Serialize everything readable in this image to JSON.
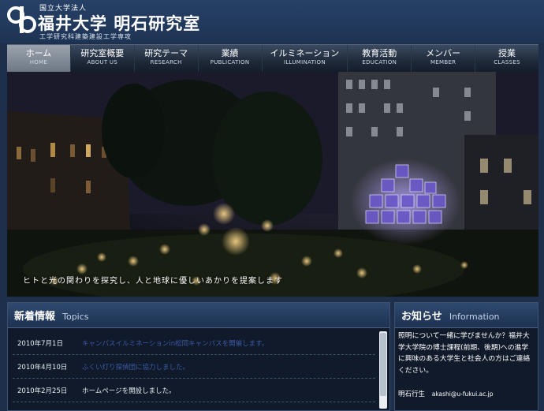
{
  "header": {
    "org": "国立大学法人",
    "title": "福井大学 明石研究室",
    "dept": "工学研究科建築建設工学専攻"
  },
  "nav": [
    {
      "jp": "ホーム",
      "en": "HOME",
      "active": true
    },
    {
      "jp": "研究室概要",
      "en": "ABOUT US"
    },
    {
      "jp": "研究テーマ",
      "en": "RESEARCH"
    },
    {
      "jp": "業績",
      "en": "PUBLICATION"
    },
    {
      "jp": "イルミネーション",
      "en": "ILLUMINATION"
    },
    {
      "jp": "教育活動",
      "en": "EDUCATION"
    },
    {
      "jp": "メンバー",
      "en": "MEMBER"
    },
    {
      "jp": "授業",
      "en": "CLASSES"
    }
  ],
  "hero": {
    "caption": "ヒトと光の関わりを探究し、人と地球に優しいあかりを提案します"
  },
  "topics": {
    "title_jp": "新着情報",
    "title_en": "Topics",
    "items": [
      {
        "date": "2010年7月1日",
        "text": "キャンパスイルミネーションin松岡キャンパスを開催します。",
        "link": true
      },
      {
        "date": "2010年4月10日",
        "text": "ふくい灯り探偵団に協力しました。",
        "link": true
      },
      {
        "date": "2010年2月25日",
        "text": "ホームページを開設しました。",
        "link": false
      }
    ]
  },
  "info": {
    "title_jp": "お知らせ",
    "title_en": "Information",
    "body": "照明について一緒に学びませんか？福井大学大学院の博士課程(前期、後期)への進学に興味のある大学生と社会人の方はご連絡ください。",
    "contact_name": "明石行生",
    "contact_mail": "akashi@u-fukui.ac.jp"
  },
  "colors": {
    "background": "#1d2f4a",
    "link": "#3b5aa6",
    "nav_active": "#8a939e"
  }
}
